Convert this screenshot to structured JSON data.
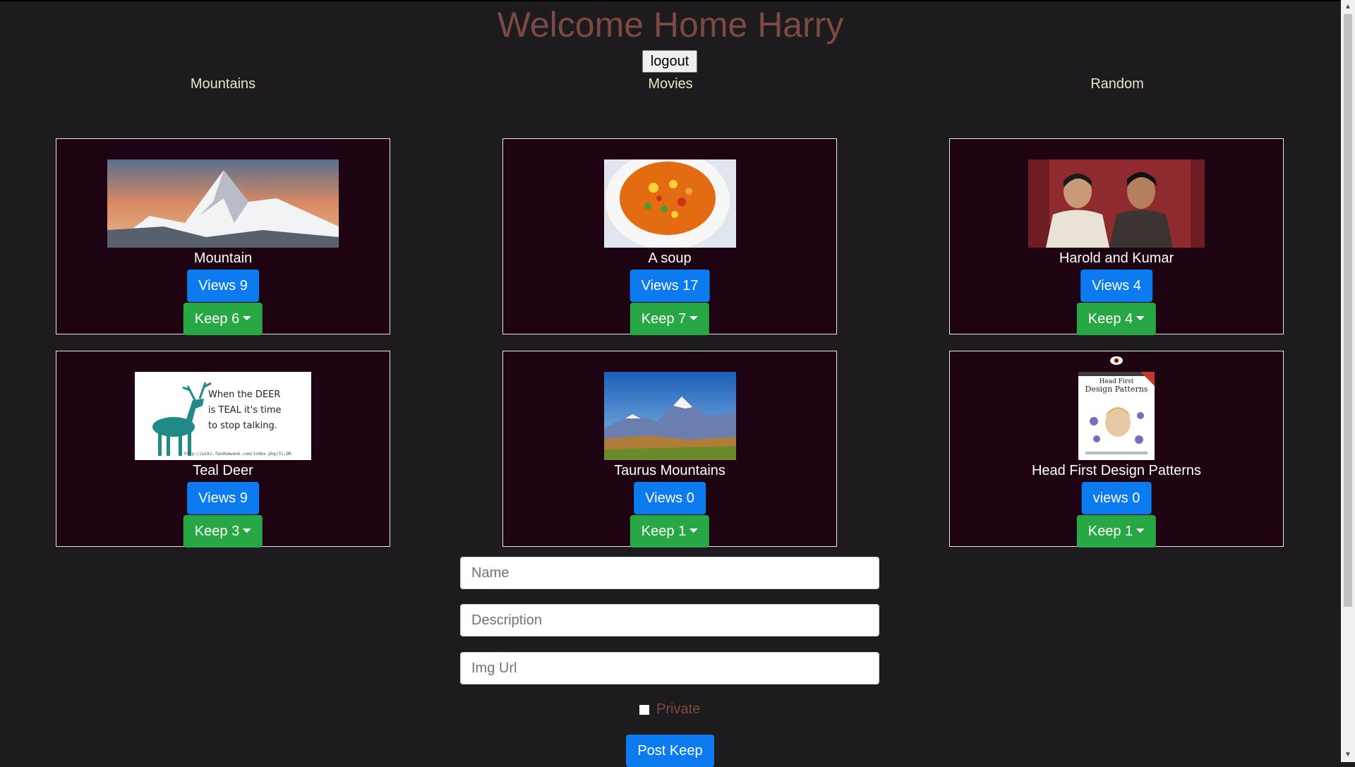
{
  "header": {
    "title": "Welcome Home Harry",
    "logout_label": "logout"
  },
  "categories": [
    "Mountains",
    "Movies",
    "Random"
  ],
  "cards": [
    {
      "name": "Mountain",
      "views_label": "Views 9",
      "keep_label": "Keep 6"
    },
    {
      "name": "A soup",
      "views_label": "Views 17",
      "keep_label": "Keep 7"
    },
    {
      "name": "Harold and Kumar",
      "views_label": "Views 4",
      "keep_label": "Keep 4"
    },
    {
      "name": "Teal Deer",
      "views_label": "Views 9",
      "keep_label": "Keep 3",
      "image_text": [
        "When the DEER",
        "is TEAL it's time",
        "to stop talking."
      ],
      "image_url_text": "http://wiki.fandomwank.com/index.php/TL;DR"
    },
    {
      "name": "Taurus Mountains",
      "views_label": "Views 0",
      "keep_label": "Keep 1"
    },
    {
      "name": "Head First Design Patterns",
      "views_label": "views 0",
      "keep_label": "Keep 1",
      "image_text": [
        "Head First",
        "Design Patterns"
      ]
    }
  ],
  "form": {
    "name_placeholder": "Name",
    "description_placeholder": "Description",
    "imgurl_placeholder": "Img Url",
    "private_label": "Private",
    "post_label": "Post Keep"
  },
  "colors": {
    "background": "#1e1b1e",
    "card_bg": "#1e0313",
    "title": "#7b4a42",
    "views": "#0d7bf0",
    "keep": "#28a745",
    "category": "#e6e6c8"
  }
}
